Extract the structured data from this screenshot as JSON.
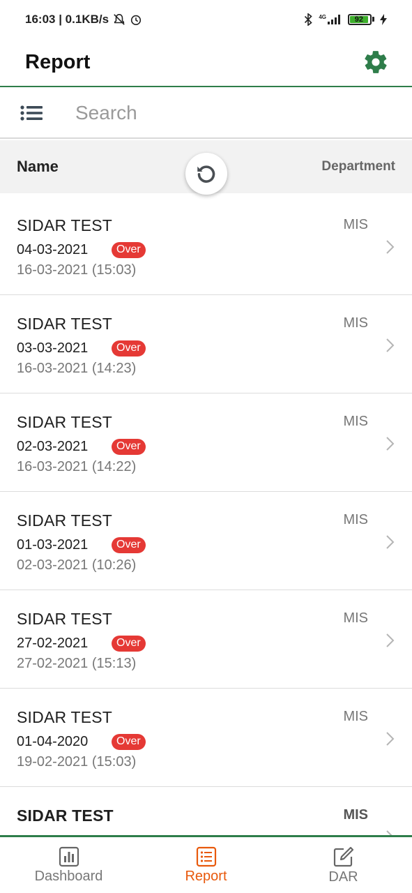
{
  "status_bar": {
    "time_speed": "16:03 | 0.1KB/s",
    "network": "4G",
    "battery": "92"
  },
  "app_bar": {
    "title": "Report",
    "settings_icon": "gear-icon"
  },
  "search": {
    "placeholder": "Search",
    "value": "",
    "filter_icon": "list-icon"
  },
  "table_header": {
    "name_label": "Name",
    "department_label": "Department",
    "refresh_icon": "refresh-icon"
  },
  "colors": {
    "accent_green": "#2e7d4a",
    "over_badge": "#e53935",
    "pending_badge": "#1a9e86",
    "active_tab": "#e8590c"
  },
  "rows": [
    {
      "name": "SIDAR TEST",
      "department": "MIS",
      "date": "04-03-2021",
      "badge": "Over",
      "updated": "16-03-2021 (15:03)"
    },
    {
      "name": "SIDAR TEST",
      "department": "MIS",
      "date": "03-03-2021",
      "badge": "Over",
      "updated": "16-03-2021 (14:23)"
    },
    {
      "name": "SIDAR TEST",
      "department": "MIS",
      "date": "02-03-2021",
      "badge": "Over",
      "updated": "16-03-2021 (14:22)"
    },
    {
      "name": "SIDAR TEST",
      "department": "MIS",
      "date": "01-03-2021",
      "badge": "Over",
      "updated": "02-03-2021 (10:26)"
    },
    {
      "name": "SIDAR TEST",
      "department": "MIS",
      "date": "27-02-2021",
      "badge": "Over",
      "updated": "27-02-2021 (15:13)"
    },
    {
      "name": "SIDAR TEST",
      "department": "MIS",
      "date": "01-04-2020",
      "badge": "Over",
      "updated": "19-02-2021 (15:03)"
    },
    {
      "name": "SIDAR TEST",
      "department": "MIS",
      "date": "",
      "badge": "",
      "updated": ""
    }
  ],
  "bottom_nav": {
    "items": [
      {
        "label": "Dashboard",
        "icon": "bar-chart-icon"
      },
      {
        "label": "Report",
        "icon": "list-box-icon"
      },
      {
        "label": "DAR",
        "icon": "edit-icon"
      }
    ],
    "active": "Report"
  }
}
